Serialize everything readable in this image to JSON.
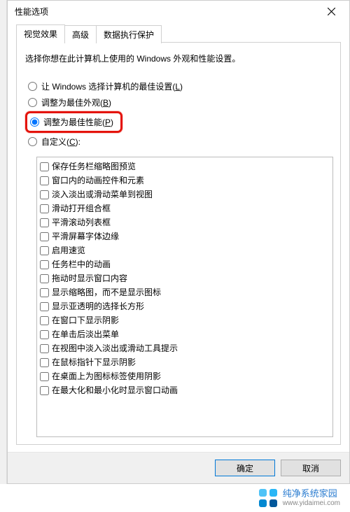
{
  "window": {
    "title": "性能选项"
  },
  "tabs": [
    {
      "label": "视觉效果",
      "active": true
    },
    {
      "label": "高级",
      "active": false
    },
    {
      "label": "数据执行保护",
      "active": false
    }
  ],
  "description": "选择你想在此计算机上使用的 Windows 外观和性能设置。",
  "radios": {
    "auto": {
      "label_pre": "让 Windows 选择计算机的最佳设置(",
      "accel": "L",
      "label_post": ")"
    },
    "look": {
      "label_pre": "调整为最佳外观(",
      "accel": "B",
      "label_post": ")"
    },
    "perf": {
      "label_pre": "调整为最佳性能(",
      "accel": "P",
      "label_post": ")"
    },
    "custom": {
      "label_pre": "自定义(",
      "accel": "C",
      "label_post": "):"
    }
  },
  "selected_radio": "perf",
  "checkboxes": [
    "保存任务栏缩略图预览",
    "窗口内的动画控件和元素",
    "淡入淡出或滑动菜单到视图",
    "滑动打开组合框",
    "平滑滚动列表框",
    "平滑屏幕字体边缘",
    "启用速览",
    "任务栏中的动画",
    "拖动时显示窗口内容",
    "显示缩略图，而不是显示图标",
    "显示亚透明的选择长方形",
    "在窗口下显示阴影",
    "在单击后淡出菜单",
    "在视图中淡入淡出或滑动工具提示",
    "在鼠标指针下显示阴影",
    "在桌面上为图标标签使用阴影",
    "在最大化和最小化时显示窗口动画"
  ],
  "buttons": {
    "ok": "确定",
    "cancel": "取消"
  },
  "watermark": {
    "brand": "纯净系统家园",
    "url": "www.yidaimei.com"
  }
}
